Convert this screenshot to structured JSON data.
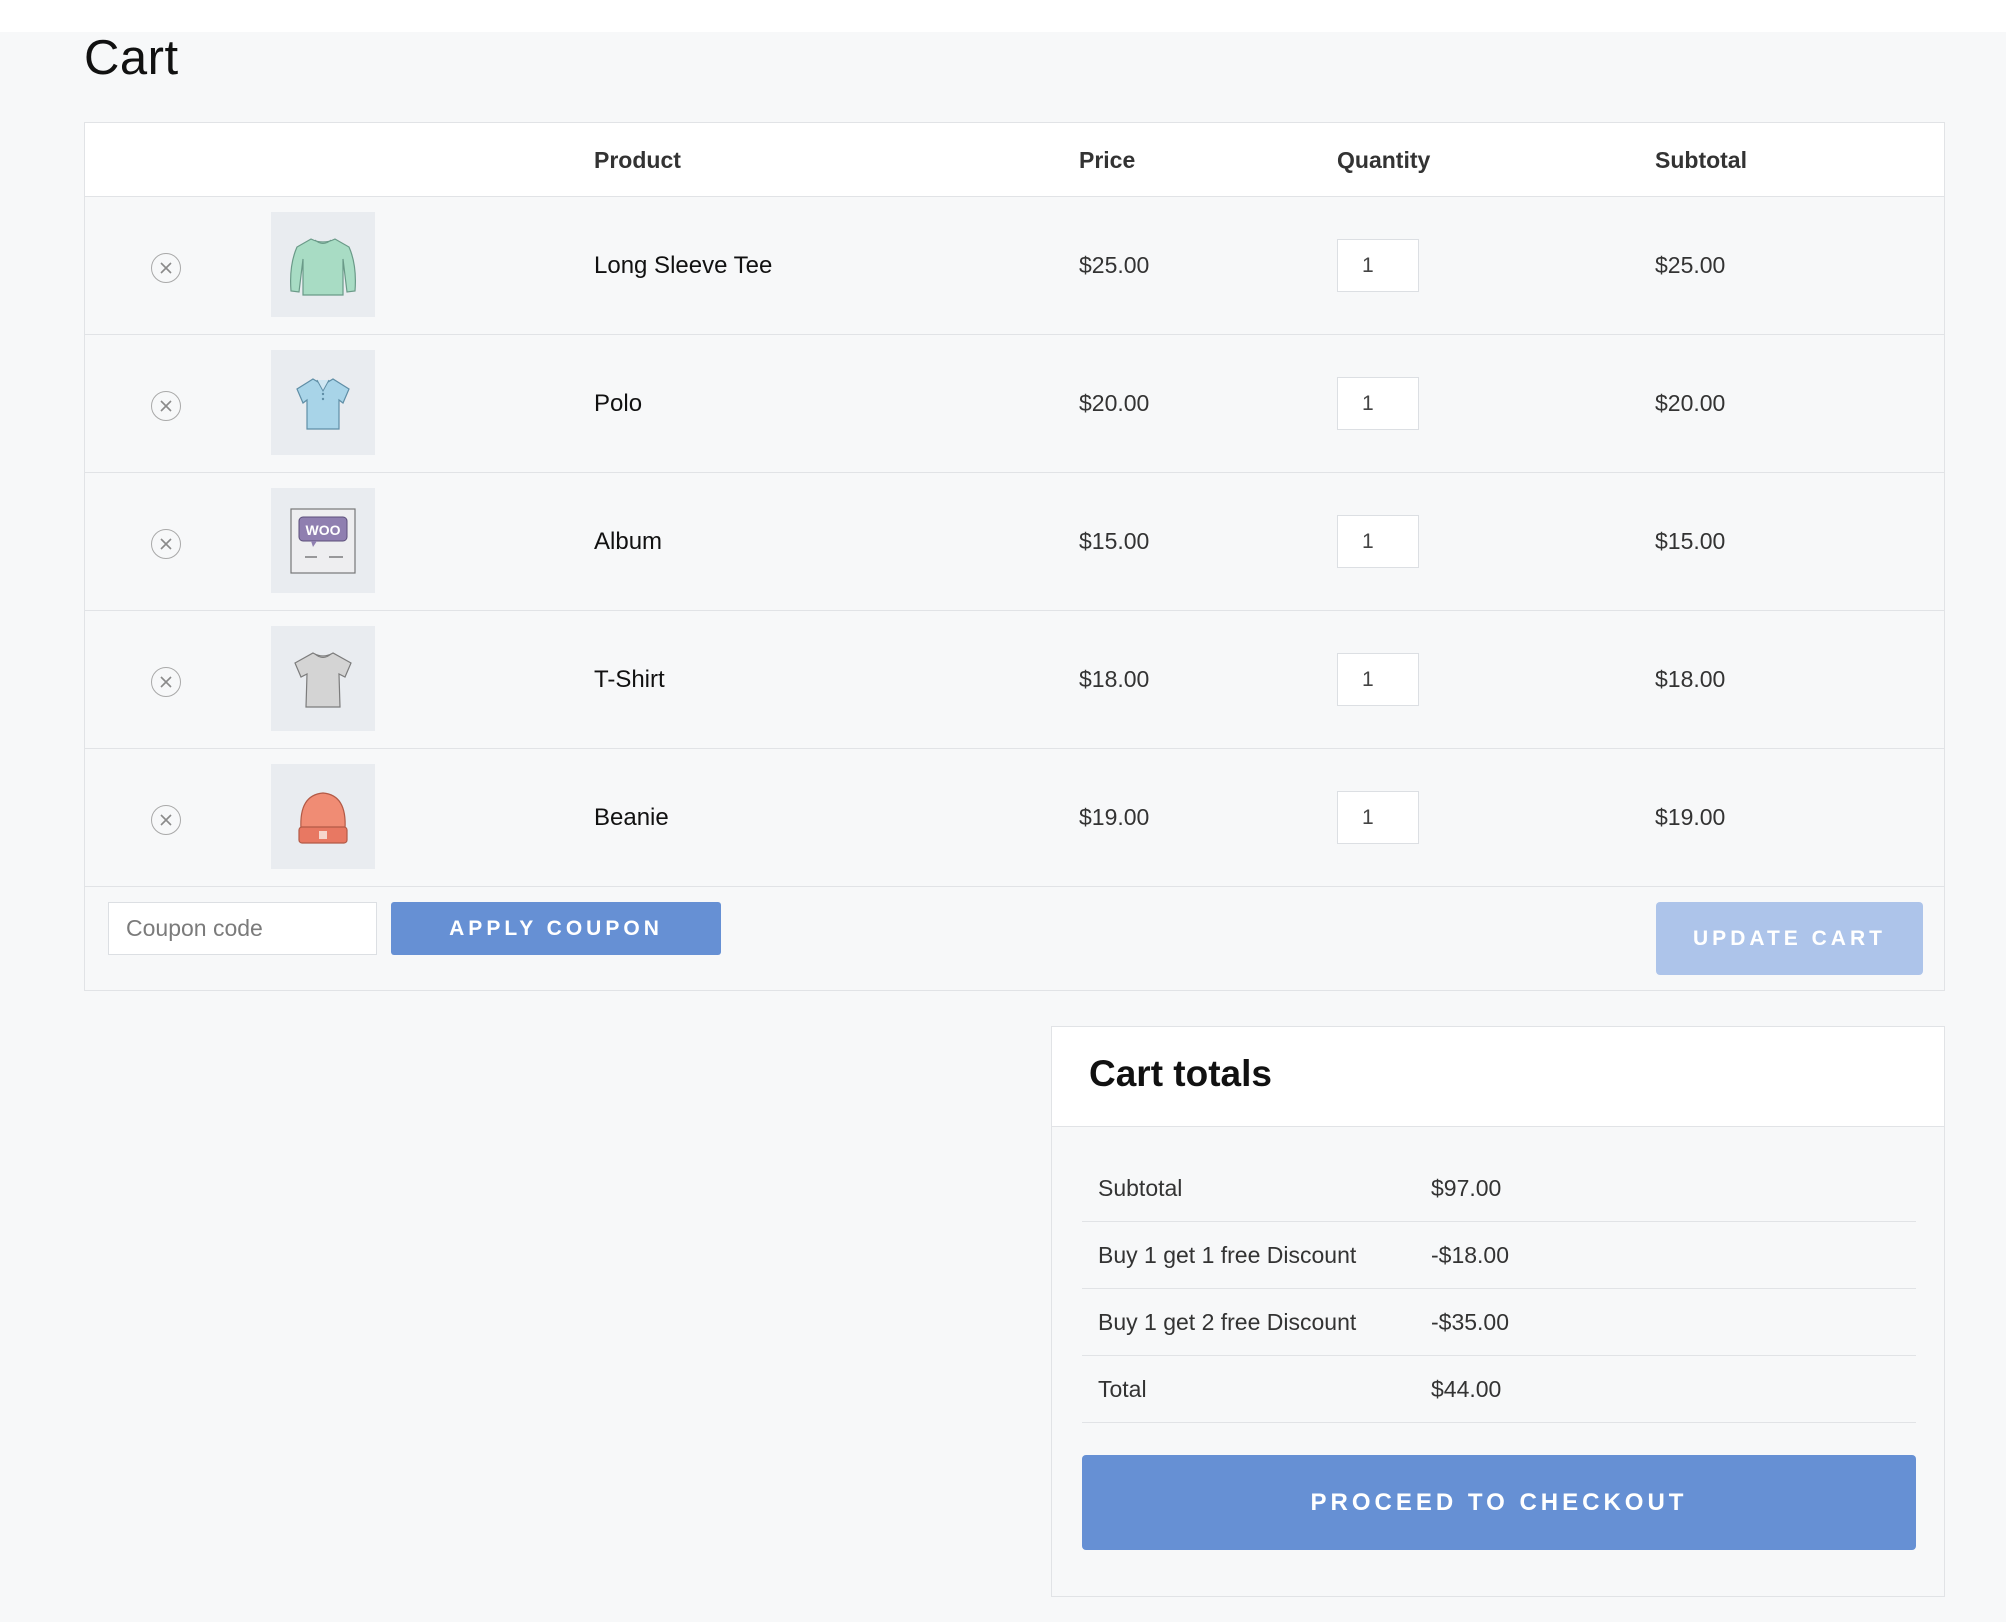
{
  "page": {
    "title": "Cart"
  },
  "table": {
    "headers": {
      "product": "Product",
      "price": "Price",
      "quantity": "Quantity",
      "subtotal": "Subtotal"
    },
    "items": [
      {
        "name": "Long Sleeve Tee",
        "price": "$25.00",
        "quantity": "1",
        "subtotal": "$25.00",
        "thumb_icon": "long-sleeve-tee-thumbnail"
      },
      {
        "name": "Polo",
        "price": "$20.00",
        "quantity": "1",
        "subtotal": "$20.00",
        "thumb_icon": "polo-thumbnail"
      },
      {
        "name": "Album",
        "price": "$15.00",
        "quantity": "1",
        "subtotal": "$15.00",
        "thumb_icon": "album-thumbnail",
        "thumb_text": "WOO"
      },
      {
        "name": "T-Shirt",
        "price": "$18.00",
        "quantity": "1",
        "subtotal": "$18.00",
        "thumb_icon": "tshirt-thumbnail"
      },
      {
        "name": "Beanie",
        "price": "$19.00",
        "quantity": "1",
        "subtotal": "$19.00",
        "thumb_icon": "beanie-thumbnail"
      }
    ]
  },
  "actions": {
    "coupon_placeholder": "Coupon code",
    "apply_coupon_label": "APPLY COUPON",
    "update_cart_label": "UPDATE CART"
  },
  "totals": {
    "title": "Cart totals",
    "rows": [
      {
        "label": "Subtotal",
        "value": "$97.00"
      },
      {
        "label": "Buy 1 get 1 free Discount",
        "value": "-$18.00"
      },
      {
        "label": "Buy 1 get 2 free Discount",
        "value": "-$35.00"
      },
      {
        "label": "Total",
        "value": "$44.00"
      }
    ],
    "checkout_label": "PROCEED TO CHECKOUT"
  },
  "colors": {
    "accent": "#6690d4",
    "accent_disabled": "#adc4ea",
    "background": "#f7f8f9",
    "border": "#e1e3e6"
  }
}
